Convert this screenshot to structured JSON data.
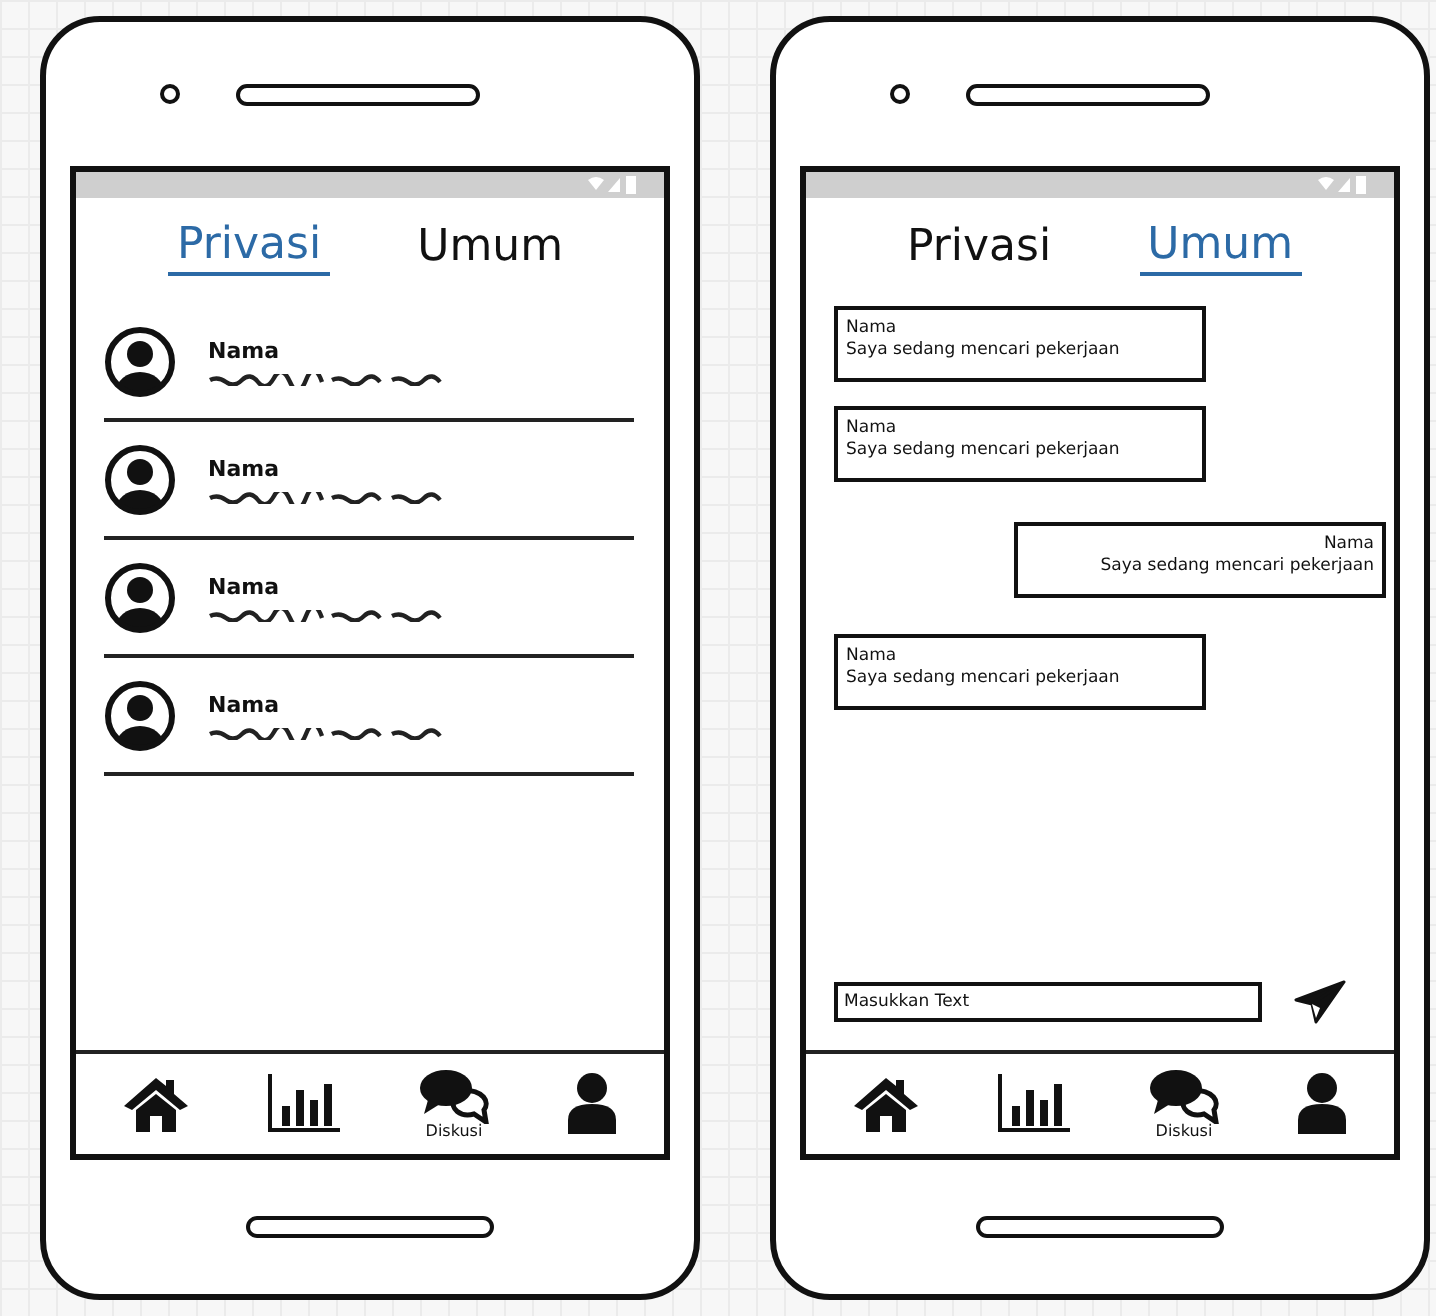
{
  "phones": [
    {
      "kind": "contacts",
      "tabs": [
        {
          "label": "Privasi",
          "selected": true
        },
        {
          "label": "Umum",
          "selected": false
        }
      ],
      "contacts": [
        {
          "name": "Nama"
        },
        {
          "name": "Nama"
        },
        {
          "name": "Nama"
        },
        {
          "name": "Nama"
        }
      ],
      "nav": [
        {
          "kind": "home"
        },
        {
          "kind": "chart"
        },
        {
          "kind": "chat",
          "label": "Diskusi"
        },
        {
          "kind": "person"
        }
      ]
    },
    {
      "kind": "chat",
      "tabs": [
        {
          "label": "Privasi",
          "selected": false
        },
        {
          "label": "Umum",
          "selected": true
        }
      ],
      "messages": [
        {
          "name": "Nama",
          "text": "Saya sedang mencari pekerjaan",
          "outgoing": false
        },
        {
          "name": "Nama",
          "text": "Saya sedang mencari pekerjaan",
          "outgoing": false
        },
        {
          "name": "Nama",
          "text": "Saya sedang mencari pekerjaan",
          "outgoing": true
        },
        {
          "name": "Nama",
          "text": "Saya sedang mencari pekerjaan",
          "outgoing": false
        }
      ],
      "input": {
        "placeholder": "Masukkan Text"
      },
      "nav": [
        {
          "kind": "home"
        },
        {
          "kind": "chart"
        },
        {
          "kind": "chat",
          "label": "Diskusi"
        },
        {
          "kind": "person"
        }
      ]
    }
  ]
}
